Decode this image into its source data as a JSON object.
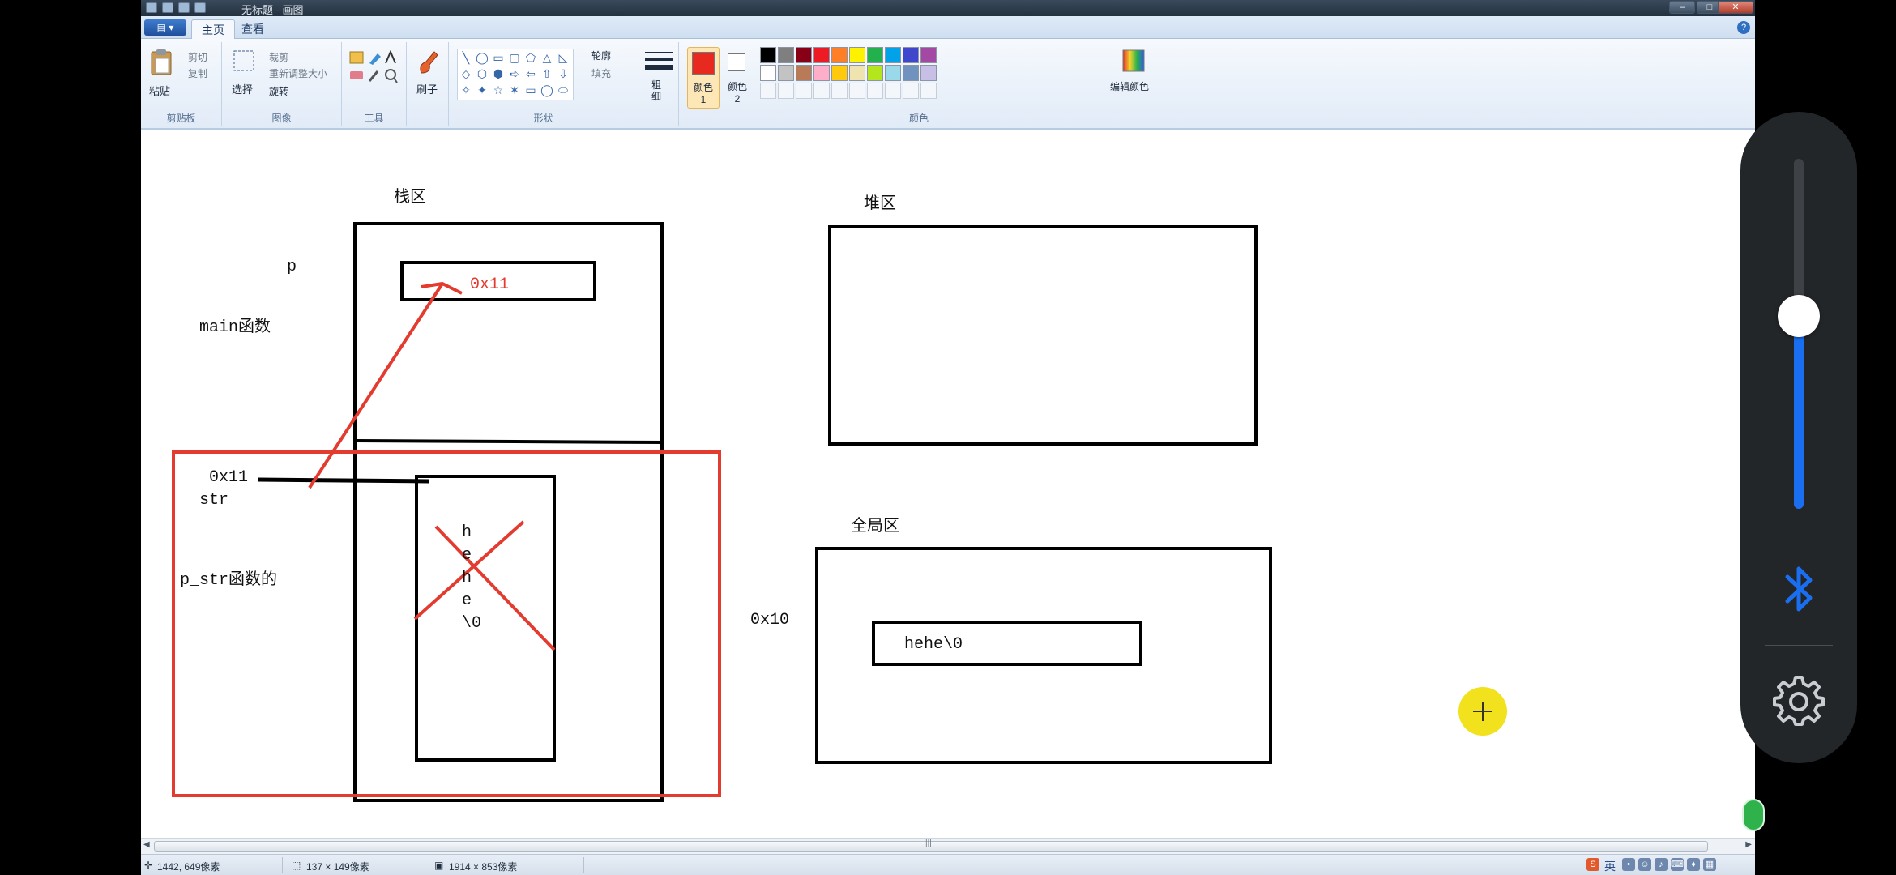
{
  "app": {
    "title": "无标题 - 画图",
    "tabs": [
      "主页",
      "查看"
    ],
    "menu_button": "▤ ▾",
    "help": "?",
    "window_buttons": [
      "–",
      "□",
      "✕"
    ]
  },
  "ribbon": {
    "clipboard": {
      "group_label": "剪贴板",
      "paste": "粘贴",
      "cut": "剪切",
      "copy": "复制"
    },
    "image": {
      "group_label": "图像",
      "select": "选择",
      "crop": "裁剪",
      "resize": "重新调整大小",
      "rotate": "旋转"
    },
    "tools": {
      "group_label": "工具"
    },
    "brushes": {
      "label": "刷子"
    },
    "shapes": {
      "group_label": "形状",
      "outline": "轮廓",
      "fill": "填充",
      "icons": [
        "╲",
        "◯",
        "▭",
        "▢",
        "⬠",
        "△",
        "◺",
        "◇",
        "⬡",
        "⬢",
        "➪",
        "⇦",
        "⇧",
        "⇩",
        "✧",
        "✦",
        "☆",
        "✶",
        "▭",
        "◯",
        "⬭"
      ]
    },
    "size": {
      "label": "粗细"
    },
    "colors": {
      "group_label": "颜色",
      "color1_label": "颜色 1",
      "color2_label": "颜色 2",
      "edit_label": "编辑颜色",
      "color1": "#e8291f",
      "color2": "#ffffff",
      "palette_row1": [
        "#000000",
        "#7f7f7f",
        "#880015",
        "#ed1c24",
        "#ff7f27",
        "#fff200",
        "#22b14c",
        "#00a2e8",
        "#3f48cc",
        "#a349a4"
      ],
      "palette_row2": [
        "#ffffff",
        "#c3c3c3",
        "#b97a57",
        "#ffaec9",
        "#ffc90e",
        "#efe4b0",
        "#b5e61d",
        "#99d9ea",
        "#7092be",
        "#c8bfe7"
      ]
    }
  },
  "canvas": {
    "stack_label": "栈区",
    "heap_label": "堆区",
    "global_label": "全局区",
    "p_label": "p",
    "main_label": "main函数",
    "p_value": "0x11",
    "str_addr": "0x11",
    "str_label": "str",
    "p_str_label": "p_str函数的",
    "chars": [
      "h",
      "e",
      "h",
      "e",
      "\\0"
    ],
    "addr_0x10": "0x10",
    "global_string": "hehe\\0"
  },
  "statusbar": {
    "position": "1442, 649像素",
    "selection_size": "137 × 149像素",
    "image_size": "1914 × 853像素",
    "ime": "英"
  },
  "side_panel": {
    "volume_level": 0.55,
    "volume_icon": "volume-slider",
    "bluetooth_icon": "bluetooth-icon",
    "settings_icon": "gear-icon"
  }
}
